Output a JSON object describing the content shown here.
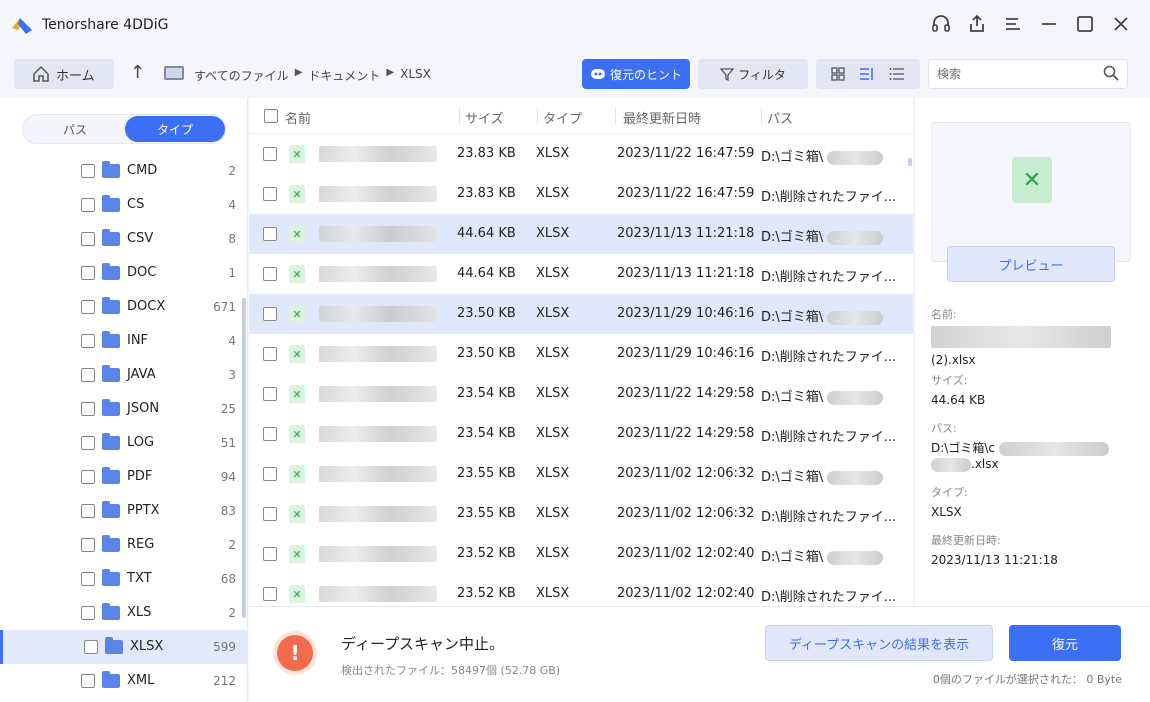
{
  "app": {
    "title": "Tenorshare 4DDiG"
  },
  "toolbar": {
    "home_label": "ホーム",
    "breadcrumb": [
      "すべてのファイル",
      "ドキュメント",
      "XLSX"
    ],
    "hint_label": "復元のヒント",
    "filter_label": "フィルタ",
    "search_placeholder": "検索"
  },
  "sidebar": {
    "tab_path": "パス",
    "tab_type": "タイプ",
    "active_tab": "タイプ",
    "types": [
      {
        "name": "CMD",
        "count": "2"
      },
      {
        "name": "CS",
        "count": "4"
      },
      {
        "name": "CSV",
        "count": "8"
      },
      {
        "name": "DOC",
        "count": "1"
      },
      {
        "name": "DOCX",
        "count": "671"
      },
      {
        "name": "INF",
        "count": "4"
      },
      {
        "name": "JAVA",
        "count": "3"
      },
      {
        "name": "JSON",
        "count": "25"
      },
      {
        "name": "LOG",
        "count": "51"
      },
      {
        "name": "PDF",
        "count": "94"
      },
      {
        "name": "PPTX",
        "count": "83"
      },
      {
        "name": "REG",
        "count": "2"
      },
      {
        "name": "TXT",
        "count": "68"
      },
      {
        "name": "XLS",
        "count": "2"
      },
      {
        "name": "XLSX",
        "count": "599",
        "selected": true
      },
      {
        "name": "XML",
        "count": "212"
      }
    ]
  },
  "file_list": {
    "columns": {
      "name": "名前",
      "size": "サイズ",
      "type": "タイプ",
      "modified": "最終更新日時",
      "path": "パス"
    },
    "rows": [
      {
        "size": "23.83 KB",
        "type": "XLSX",
        "modified": "2023/11/22 16:47:59",
        "path": "D:\\ゴミ箱\\",
        "selected": false
      },
      {
        "size": "23.83 KB",
        "type": "XLSX",
        "modified": "2023/11/22 16:47:59",
        "path": "D:\\削除されたファイ...",
        "selected": false
      },
      {
        "size": "44.64 KB",
        "type": "XLSX",
        "modified": "2023/11/13 11:21:18",
        "path": "D:\\ゴミ箱\\",
        "selected": true
      },
      {
        "size": "44.64 KB",
        "type": "XLSX",
        "modified": "2023/11/13 11:21:18",
        "path": "D:\\削除されたファイ...",
        "selected": false
      },
      {
        "size": "23.50 KB",
        "type": "XLSX",
        "modified": "2023/11/29 10:46:16",
        "path": "D:\\ゴミ箱\\",
        "selected": true
      },
      {
        "size": "23.50 KB",
        "type": "XLSX",
        "modified": "2023/11/29 10:46:16",
        "path": "D:\\削除されたファイ...",
        "selected": false
      },
      {
        "size": "23.54 KB",
        "type": "XLSX",
        "modified": "2023/11/22 14:29:58",
        "path": "D:\\ゴミ箱\\",
        "selected": false
      },
      {
        "size": "23.54 KB",
        "type": "XLSX",
        "modified": "2023/11/22 14:29:58",
        "path": "D:\\削除されたファイ...",
        "selected": false
      },
      {
        "size": "23.55 KB",
        "type": "XLSX",
        "modified": "2023/11/02 12:06:32",
        "path": "D:\\ゴミ箱\\",
        "selected": false
      },
      {
        "size": "23.55 KB",
        "type": "XLSX",
        "modified": "2023/11/02 12:06:32",
        "path": "D:\\削除されたファイ...",
        "selected": false
      },
      {
        "size": "23.52 KB",
        "type": "XLSX",
        "modified": "2023/11/02 12:02:40",
        "path": "D:\\ゴミ箱\\",
        "selected": false
      },
      {
        "size": "23.52 KB",
        "type": "XLSX",
        "modified": "2023/11/02 12:02:40",
        "path": "D:\\削除されたファイ...",
        "selected": false
      }
    ]
  },
  "preview": {
    "button_label": "プレビュー",
    "name_label": "名前:",
    "name_value_suffix": "(2).xlsx",
    "size_label": "サイズ:",
    "size_value": "44.64 KB",
    "path_label": "パス:",
    "path_value_prefix": "D:\\ゴミ箱\\c",
    "path_value_suffix": ".xlsx",
    "type_label": "タイプ:",
    "type_value": "XLSX",
    "modified_label": "最終更新日時:",
    "modified_value": "2023/11/13 11:21:18"
  },
  "status": {
    "title": "ディープスキャン中止。",
    "detected": "検出されたファイル：58497個 (52.78 GB)",
    "deep_results_label": "ディープスキャンの結果を表示",
    "recover_label": "復元",
    "selected_summary": "0個のファイルが選択された： 0 Byte"
  },
  "colors": {
    "accent": "#3b6ff5",
    "selected_row": "#dfe7fb",
    "warning": "#f26b4c",
    "excel_green": "#2aa04a"
  }
}
